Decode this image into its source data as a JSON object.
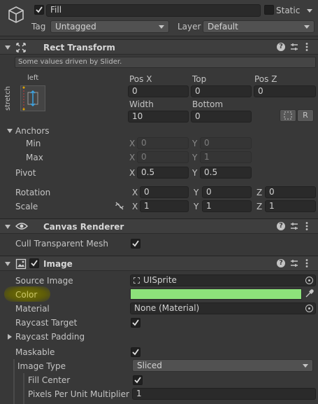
{
  "gameobject": {
    "name": "Fill",
    "static_label": "Static",
    "tag_label": "Tag",
    "tag_value": "Untagged",
    "layer_label": "Layer",
    "layer_value": "Default"
  },
  "rect_transform": {
    "title": "Rect Transform",
    "info": "Some values driven by Slider.",
    "anchor_h": "left",
    "anchor_v": "stretch",
    "pos_x_label": "Pos X",
    "pos_x": "0",
    "top_label": "Top",
    "top": "0",
    "pos_z_label": "Pos Z",
    "pos_z": "0",
    "width_label": "Width",
    "width": "10",
    "bottom_label": "Bottom",
    "bottom": "0",
    "r_button": "R",
    "anchors_label": "Anchors",
    "min_label": "Min",
    "min_x": "0",
    "min_y": "0",
    "max_label": "Max",
    "max_x": "0",
    "max_y": "1",
    "pivot_label": "Pivot",
    "pivot_x": "0.5",
    "pivot_y": "0.5",
    "rotation_label": "Rotation",
    "rot_x": "0",
    "rot_y": "0",
    "rot_z": "0",
    "scale_label": "Scale",
    "scale_x": "1",
    "scale_y": "1",
    "scale_z": "1",
    "x": "X",
    "y": "Y",
    "z": "Z"
  },
  "canvas_renderer": {
    "title": "Canvas Renderer",
    "cull_label": "Cull Transparent Mesh"
  },
  "image": {
    "title": "Image",
    "source_label": "Source Image",
    "source_value": "UISprite",
    "color_label": "Color",
    "color_value": "#8de27a",
    "material_label": "Material",
    "material_value": "None (Material)",
    "raycast_target_label": "Raycast Target",
    "raycast_padding_label": "Raycast Padding",
    "maskable_label": "Maskable",
    "image_type_label": "Image Type",
    "image_type_value": "Sliced",
    "fill_center_label": "Fill Center",
    "ppu_label": "Pixels Per Unit Multiplier",
    "ppu_value": "1"
  },
  "colors": {
    "highlight": "#6f6e00",
    "accent": "#8de27a"
  }
}
